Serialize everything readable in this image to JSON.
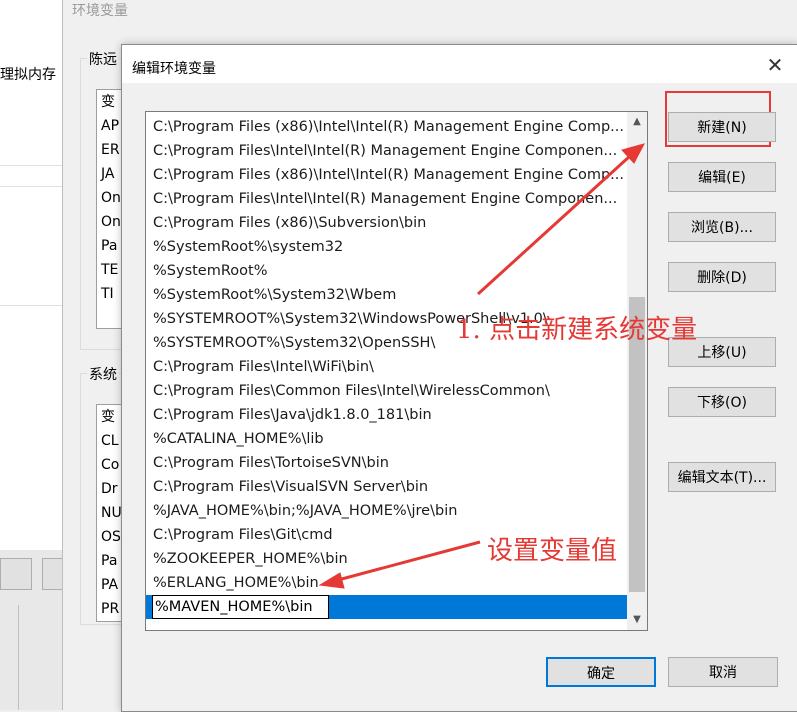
{
  "background_window": {
    "left_fragment": "理拟内存"
  },
  "env_window": {
    "title": "环境变量",
    "user_group_label": "陈远",
    "user_vars": [
      "变",
      "AP",
      "ER",
      "JA",
      "On",
      "On",
      "Pa",
      "TE",
      "TI"
    ],
    "system_group_label": "系统",
    "system_vars": [
      "变",
      "CL",
      "Co",
      "Dr",
      "NU",
      "OS",
      "Pa",
      "PA",
      "PR"
    ]
  },
  "dialog": {
    "title": "编辑环境变量",
    "close_glyph": "✕",
    "paths": [
      "C:\\Program Files (x86)\\Intel\\Intel(R) Management Engine Comp...",
      "C:\\Program Files\\Intel\\Intel(R) Management Engine Componen...",
      "C:\\Program Files (x86)\\Intel\\Intel(R) Management Engine Comp...",
      "C:\\Program Files\\Intel\\Intel(R) Management Engine Componen...",
      "C:\\Program Files (x86)\\Subversion\\bin",
      "%SystemRoot%\\system32",
      "%SystemRoot%",
      "%SystemRoot%\\System32\\Wbem",
      "%SYSTEMROOT%\\System32\\WindowsPowerShell\\v1.0\\",
      "%SYSTEMROOT%\\System32\\OpenSSH\\",
      "C:\\Program Files\\Intel\\WiFi\\bin\\",
      "C:\\Program Files\\Common Files\\Intel\\WirelessCommon\\",
      "C:\\Program Files\\Java\\jdk1.8.0_181\\bin",
      "%CATALINA_HOME%\\lib",
      "C:\\Program Files\\TortoiseSVN\\bin",
      "C:\\Program Files\\VisualSVN Server\\bin",
      "%JAVA_HOME%\\bin;%JAVA_HOME%\\jre\\bin",
      "C:\\Program Files\\Git\\cmd",
      "%ZOOKEEPER_HOME%\\bin",
      "%ERLANG_HOME%\\bin"
    ],
    "editing_value": "%MAVEN_HOME%\\bin",
    "buttons": {
      "new": "新建(N)",
      "edit": "编辑(E)",
      "browse": "浏览(B)...",
      "delete": "删除(D)",
      "move_up": "上移(U)",
      "move_down": "下移(O)",
      "edit_text": "编辑文本(T)...",
      "ok": "确定",
      "cancel": "取消"
    }
  },
  "annotations": {
    "step1": "1. 点击新建系统变量",
    "step2": "设置变量值",
    "color": "#e53935"
  },
  "colors": {
    "selection": "#0078d7",
    "window_bg": "#f0f0f0"
  }
}
